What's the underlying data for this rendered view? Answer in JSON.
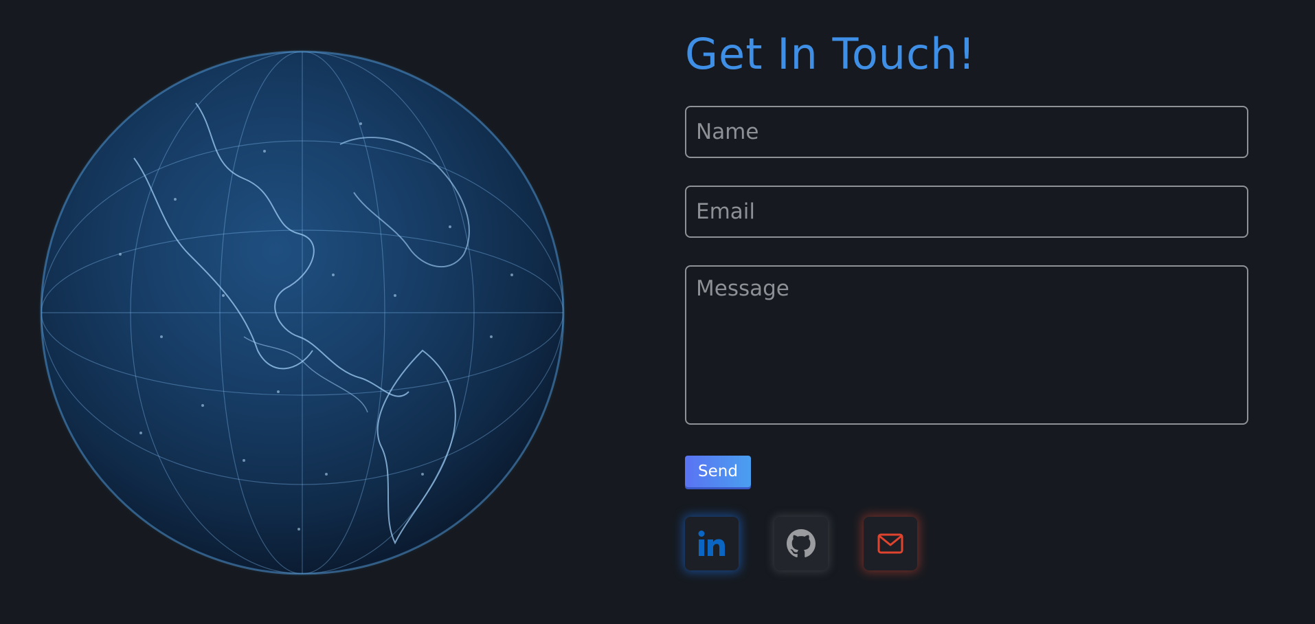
{
  "contact": {
    "title": "Get In Touch!",
    "name_placeholder": "Name",
    "email_placeholder": "Email",
    "message_placeholder": "Message",
    "send_label": "Send"
  },
  "socials": [
    {
      "name": "LinkedIn",
      "icon": "linkedin-icon",
      "color": "#0a66c2"
    },
    {
      "name": "GitHub",
      "icon": "github-icon",
      "color": "#9a9ca0"
    },
    {
      "name": "Email",
      "icon": "mail-icon",
      "color": "#e0442e"
    }
  ],
  "colors": {
    "background": "#161a20",
    "accent": "#3f8fe6",
    "field_border": "#8f9296"
  },
  "globe": {
    "icon": "earth-globe-image"
  }
}
